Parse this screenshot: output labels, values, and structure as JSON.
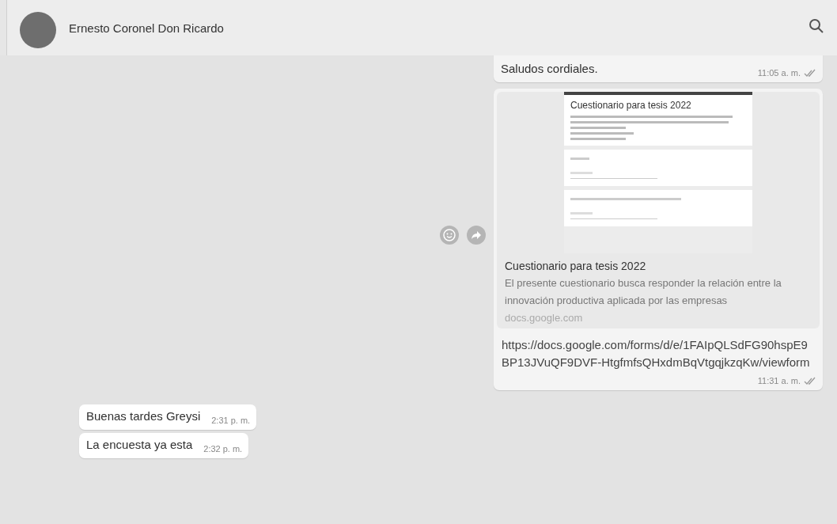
{
  "header": {
    "contact_name": "Ernesto Coronel Don Ricardo"
  },
  "messages": [
    {
      "kind": "text",
      "incoming": false,
      "text": "Saludos cordiales.",
      "time": "11:05 a. m.",
      "read": true
    },
    {
      "kind": "link",
      "incoming": false,
      "preview": {
        "form_title": "Cuestionario para tesis 2022",
        "title": "Cuestionario para tesis 2022",
        "description": "El presente cuestionario busca responder la relación entre la innovación productiva aplicada por las empresas",
        "domain": "docs.google.com"
      },
      "text": "https://docs.google.com/forms/d/e/1FAIpQLSdFG90hspE9BP13JVuQF9DVF-HtgfmfsQHxdmBqVtgqjkzqKw/viewform",
      "time": "11:31 a. m.",
      "read": true
    },
    {
      "kind": "text",
      "incoming": true,
      "text": "Buenas tardes Greysi",
      "time": "2:31 p. m."
    },
    {
      "kind": "text",
      "incoming": true,
      "text": "La encuesta ya esta",
      "time": "2:32 p. m."
    }
  ]
}
